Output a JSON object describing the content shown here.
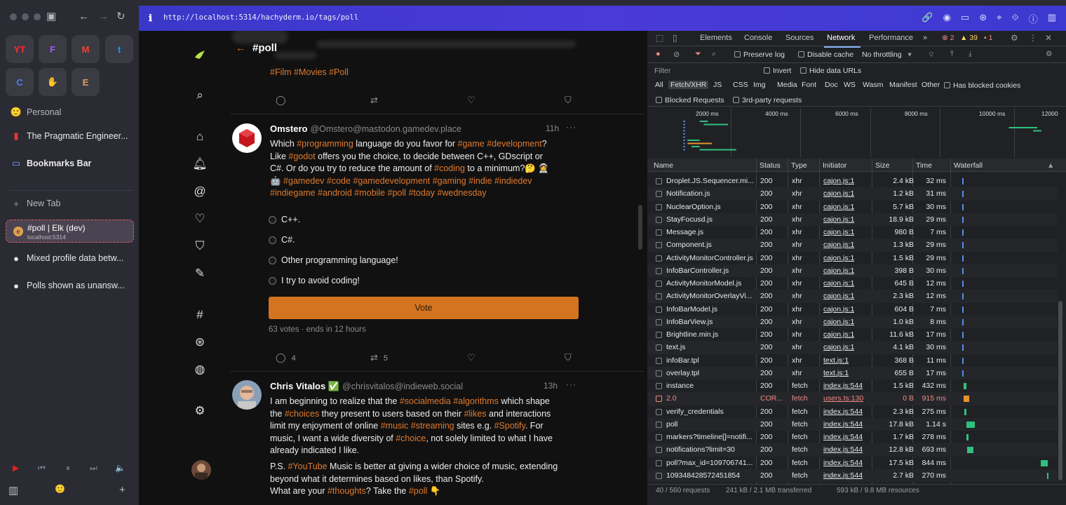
{
  "browser": {
    "url": "http://localhost:5314/hachyderm.io/tags/poll",
    "favorites": [
      {
        "label": "YT",
        "color": "#ff2a2a"
      },
      {
        "label": "F",
        "color": "#a259ff"
      },
      {
        "label": "M",
        "color": "#ea4335"
      },
      {
        "label": "t",
        "color": "#1d9bf0"
      },
      {
        "label": "C",
        "color": "#4285f4"
      },
      {
        "label": "✋",
        "color": "#8a7cf0"
      },
      {
        "label": "E",
        "color": "#e0a050"
      }
    ],
    "sidebar": {
      "space": "Personal",
      "items": [
        "The Pragmatic Engineer...",
        "Bookmarks Bar"
      ],
      "new_tab": "New Tab",
      "active_tab": {
        "title": "#poll | Elk (dev)",
        "subtitle": "localhost:5314"
      },
      "tabs": [
        "Mixed profile data betw...",
        "Polls shown as unansw..."
      ]
    }
  },
  "elk": {
    "header_title": "#poll",
    "post1_tags": [
      "#Film",
      "#Movies",
      "#Poll"
    ],
    "post2": {
      "name": "Omstero",
      "handle": "@Omstero@mastodon.gamedev.place",
      "time": "11h",
      "body_lines": [
        [
          [
            "Which ",
            0
          ],
          [
            "#programming",
            1
          ],
          [
            " language do you favor for ",
            0
          ],
          [
            "#game",
            1
          ],
          [
            " ",
            0
          ],
          [
            "#development",
            1
          ],
          [
            "?",
            0
          ]
        ],
        [
          [
            "Like ",
            0
          ],
          [
            "#godot",
            1
          ],
          [
            "  offers you the choice, to decide between C++, GDscript or",
            0
          ]
        ],
        [
          [
            "C#. Or do you try to reduce the amount of ",
            0
          ],
          [
            "#coding",
            1
          ],
          [
            " to a minimum?🤔 🧑‍🚀",
            0
          ]
        ],
        [
          [
            "🤖 ",
            0
          ],
          [
            "#gamedev",
            1
          ],
          [
            " ",
            0
          ],
          [
            "#code",
            1
          ],
          [
            " ",
            0
          ],
          [
            "#gamedevelopment",
            1
          ],
          [
            "  ",
            0
          ],
          [
            "#gaming",
            1
          ],
          [
            " ",
            0
          ],
          [
            "#indie",
            1
          ],
          [
            " ",
            0
          ],
          [
            "#indiedev",
            1
          ]
        ],
        [
          [
            "#indiegame",
            1
          ],
          [
            " ",
            0
          ],
          [
            "#android",
            1
          ],
          [
            " ",
            0
          ],
          [
            "#mobile",
            1
          ],
          [
            "  ",
            0
          ],
          [
            "#poll",
            1
          ],
          [
            "  ",
            0
          ],
          [
            "#today",
            1
          ],
          [
            " ",
            0
          ],
          [
            "#wednesday",
            1
          ]
        ]
      ],
      "poll_options": [
        "C++.",
        "C#.",
        "Other programming language!",
        "I try to avoid coding!"
      ],
      "vote_label": "Vote",
      "poll_meta": "63 votes · ends in 12 hours",
      "replies": "4",
      "boosts": "5"
    },
    "post3": {
      "name": "Chris Vitalos ✅",
      "handle": "@chrisvitalos@indieweb.social",
      "time": "13h",
      "body_lines": [
        [
          [
            "I am beginning to realize that the ",
            0
          ],
          [
            "#socialmedia",
            1
          ],
          [
            " ",
            0
          ],
          [
            "#algorithms",
            1
          ],
          [
            " which shape",
            0
          ]
        ],
        [
          [
            "the ",
            0
          ],
          [
            "#choices",
            1
          ],
          [
            " they present to users based on their ",
            0
          ],
          [
            "#likes",
            1
          ],
          [
            " and interactions",
            0
          ]
        ],
        [
          [
            "limit my enjoyment of online ",
            0
          ],
          [
            "#music",
            1
          ],
          [
            " ",
            0
          ],
          [
            "#streaming",
            1
          ],
          [
            " sites e.g. ",
            0
          ],
          [
            "#Spotify",
            1
          ],
          [
            ".   For",
            0
          ]
        ],
        [
          [
            "music, I want a wide diversity of ",
            0
          ],
          [
            "#choice",
            1
          ],
          [
            ", not solely limited to what I have",
            0
          ]
        ],
        [
          [
            "already indicated I like.",
            0
          ]
        ]
      ],
      "body2_lines": [
        [
          [
            "P.S. ",
            0
          ],
          [
            "#YouTube",
            1
          ],
          [
            " Music is better at giving a wider choice of music, extending",
            0
          ]
        ],
        [
          [
            "beyond what it determines based on likes, than Spotify.",
            0
          ]
        ],
        [
          [
            "What are your ",
            0
          ],
          [
            "#thoughts",
            1
          ],
          [
            "?  Take the ",
            0
          ],
          [
            "#poll",
            1
          ],
          [
            " 👇",
            0
          ]
        ]
      ]
    }
  },
  "devtools": {
    "tabs": [
      "Elements",
      "Console",
      "Sources",
      "Network",
      "Performance"
    ],
    "selected_tab": "Network",
    "badges": {
      "errors": "2",
      "warnings": "39",
      "issues": "1"
    },
    "toolbar": {
      "preserve_log": "Preserve log",
      "disable_cache": "Disable cache",
      "throttling": "No throttling"
    },
    "filter_placeholder": "Filter",
    "invert": "Invert",
    "hide_data_urls": "Hide data URLs",
    "type_filters": [
      "All",
      "Fetch/XHR",
      "JS",
      "CSS",
      "Img",
      "Media",
      "Font",
      "Doc",
      "WS",
      "Wasm",
      "Manifest",
      "Other"
    ],
    "selected_filter": "Fetch/XHR",
    "has_blocked_cookies": "Has blocked cookies",
    "blocked_requests": "Blocked Requests",
    "third_party": "3rd-party requests",
    "overview_ticks": [
      "2000 ms",
      "4000 ms",
      "6000 ms",
      "8000 ms",
      "10000 ms",
      "12000"
    ],
    "columns": [
      "Name",
      "Status",
      "Type",
      "Initiator",
      "Size",
      "Time",
      "Waterfall"
    ],
    "rows": [
      {
        "name": "Droplet.JS.Sequencer.mi...",
        "status": "200",
        "type": "xhr",
        "initiator": "cajon.js:1",
        "size": "2.4 kB",
        "time": "32 ms",
        "wf_start": 0.08,
        "wf_len": 0.004,
        "wf_color": "#4f8ee8"
      },
      {
        "name": "Notification.js",
        "status": "200",
        "type": "xhr",
        "initiator": "cajon.js:1",
        "size": "1.2 kB",
        "time": "31 ms",
        "wf_start": 0.08,
        "wf_len": 0.004,
        "wf_color": "#4f8ee8"
      },
      {
        "name": "NuclearOption.js",
        "status": "200",
        "type": "xhr",
        "initiator": "cajon.js:1",
        "size": "5.7 kB",
        "time": "30 ms",
        "wf_start": 0.08,
        "wf_len": 0.004,
        "wf_color": "#4f8ee8"
      },
      {
        "name": "StayFocusd.js",
        "status": "200",
        "type": "xhr",
        "initiator": "cajon.js:1",
        "size": "18.9 kB",
        "time": "29 ms",
        "wf_start": 0.08,
        "wf_len": 0.004,
        "wf_color": "#4f8ee8"
      },
      {
        "name": "Message.js",
        "status": "200",
        "type": "xhr",
        "initiator": "cajon.js:1",
        "size": "980 B",
        "time": "7 ms",
        "wf_start": 0.08,
        "wf_len": 0.004,
        "wf_color": "#4f8ee8"
      },
      {
        "name": "Component.js",
        "status": "200",
        "type": "xhr",
        "initiator": "cajon.js:1",
        "size": "1.3 kB",
        "time": "29 ms",
        "wf_start": 0.08,
        "wf_len": 0.004,
        "wf_color": "#4f8ee8"
      },
      {
        "name": "ActivityMonitorController.js",
        "status": "200",
        "type": "xhr",
        "initiator": "cajon.js:1",
        "size": "1.5 kB",
        "time": "29 ms",
        "wf_start": 0.08,
        "wf_len": 0.004,
        "wf_color": "#4f8ee8"
      },
      {
        "name": "InfoBarController.js",
        "status": "200",
        "type": "xhr",
        "initiator": "cajon.js:1",
        "size": "398 B",
        "time": "30 ms",
        "wf_start": 0.08,
        "wf_len": 0.004,
        "wf_color": "#4f8ee8"
      },
      {
        "name": "ActivityMonitorModel.js",
        "status": "200",
        "type": "xhr",
        "initiator": "cajon.js:1",
        "size": "645 B",
        "time": "12 ms",
        "wf_start": 0.08,
        "wf_len": 0.004,
        "wf_color": "#4f8ee8"
      },
      {
        "name": "ActivityMonitorOverlayVi...",
        "status": "200",
        "type": "xhr",
        "initiator": "cajon.js:1",
        "size": "2.3 kB",
        "time": "12 ms",
        "wf_start": 0.08,
        "wf_len": 0.004,
        "wf_color": "#4f8ee8"
      },
      {
        "name": "InfoBarModel.js",
        "status": "200",
        "type": "xhr",
        "initiator": "cajon.js:1",
        "size": "604 B",
        "time": "7 ms",
        "wf_start": 0.08,
        "wf_len": 0.004,
        "wf_color": "#4f8ee8"
      },
      {
        "name": "InfoBarView.js",
        "status": "200",
        "type": "xhr",
        "initiator": "cajon.js:1",
        "size": "1.0 kB",
        "time": "8 ms",
        "wf_start": 0.08,
        "wf_len": 0.004,
        "wf_color": "#4f8ee8"
      },
      {
        "name": "Brightline.min.js",
        "status": "200",
        "type": "xhr",
        "initiator": "cajon.js:1",
        "size": "11.6 kB",
        "time": "17 ms",
        "wf_start": 0.08,
        "wf_len": 0.004,
        "wf_color": "#4f8ee8"
      },
      {
        "name": "text.js",
        "status": "200",
        "type": "xhr",
        "initiator": "cajon.js:1",
        "size": "4.1 kB",
        "time": "30 ms",
        "wf_start": 0.08,
        "wf_len": 0.004,
        "wf_color": "#4f8ee8"
      },
      {
        "name": "infoBar.tpl",
        "status": "200",
        "type": "xhr",
        "initiator": "text.js:1",
        "size": "368 B",
        "time": "11 ms",
        "wf_start": 0.08,
        "wf_len": 0.004,
        "wf_color": "#4f8ee8"
      },
      {
        "name": "overlay.tpl",
        "status": "200",
        "type": "xhr",
        "initiator": "text.js:1",
        "size": "655 B",
        "time": "17 ms",
        "wf_start": 0.08,
        "wf_len": 0.004,
        "wf_color": "#4f8ee8"
      },
      {
        "name": "instance",
        "status": "200",
        "type": "fetch",
        "initiator": "index.js:544",
        "size": "1.5 kB",
        "time": "432 ms",
        "wf_start": 0.09,
        "wf_len": 0.03,
        "wf_color": "#2ec27e"
      },
      {
        "name": "2.0",
        "status": "COR...",
        "type": "fetch",
        "initiator": "users.ts:130",
        "size": "0 B",
        "time": "915 ms",
        "wf_start": 0.09,
        "wf_len": 0.06,
        "wf_color": "#e8912d",
        "error": true
      },
      {
        "name": "verify_credentials",
        "status": "200",
        "type": "fetch",
        "initiator": "index.js:544",
        "size": "2.3 kB",
        "time": "275 ms",
        "wf_start": 0.1,
        "wf_len": 0.02,
        "wf_color": "#2ec27e"
      },
      {
        "name": "poll",
        "status": "200",
        "type": "fetch",
        "initiator": "index.js:544",
        "size": "17.8 kB",
        "time": "1.14 s",
        "wf_start": 0.12,
        "wf_len": 0.09,
        "wf_color": "#2ec27e"
      },
      {
        "name": "markers?timeline[]=notifi...",
        "status": "200",
        "type": "fetch",
        "initiator": "index.js:544",
        "size": "1.7 kB",
        "time": "278 ms",
        "wf_start": 0.12,
        "wf_len": 0.02,
        "wf_color": "#2ec27e"
      },
      {
        "name": "notifications?limit=30",
        "status": "200",
        "type": "fetch",
        "initiator": "index.js:544",
        "size": "12.8 kB",
        "time": "693 ms",
        "wf_start": 0.13,
        "wf_len": 0.06,
        "wf_color": "#2ec27e"
      },
      {
        "name": "poll?max_id=109706741...",
        "status": "200",
        "type": "fetch",
        "initiator": "index.js:544",
        "size": "17.5 kB",
        "time": "844 ms",
        "wf_start": 0.88,
        "wf_len": 0.07,
        "wf_color": "#2ec27e"
      },
      {
        "name": "109348428572451854",
        "status": "200",
        "type": "fetch",
        "initiator": "index.js:544",
        "size": "2.7 kB",
        "time": "270 ms",
        "wf_start": 0.94,
        "wf_len": 0.02,
        "wf_color": "#2ec27e"
      }
    ],
    "status_bar": {
      "requests": "40 / 560 requests",
      "transferred": "241 kB / 2.1 MB transferred",
      "resources": "593 kB / 9.8 MB resources"
    }
  }
}
